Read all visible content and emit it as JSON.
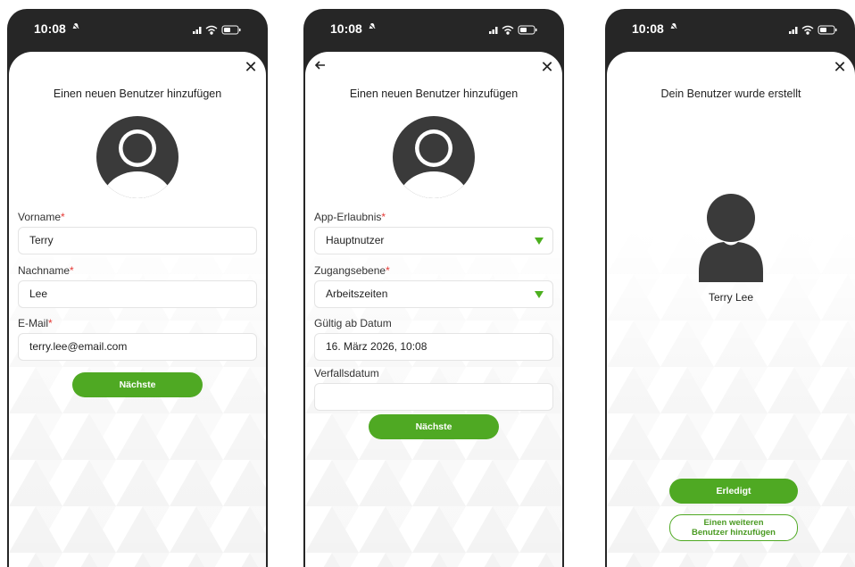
{
  "screens": [
    {
      "time": "10:08",
      "title": "Einen neuen Benutzer hinzufügen",
      "fields": [
        {
          "label": "Vorname",
          "required": "*",
          "value": "Terry"
        },
        {
          "label": "Nachname",
          "required": "*",
          "value": "Lee"
        },
        {
          "label": "E-Mail",
          "required": "*",
          "value": "terry.lee@email.com"
        }
      ],
      "next_button": "Nächste"
    },
    {
      "time": "10:08",
      "title": "Einen neuen Benutzer hinzufügen",
      "fields": [
        {
          "label": "App-Erlaubnis",
          "required": "*",
          "value": "Hauptnutzer"
        },
        {
          "label": "Zugangsebene",
          "required": "*",
          "value": "Arbeitszeiten"
        },
        {
          "label": "Gültig ab Datum",
          "value": "16. März 2026, 10:08"
        },
        {
          "label": "Verfallsdatum",
          "value": ""
        }
      ],
      "next_button": "Nächste"
    },
    {
      "time": "10:08",
      "title": "Dein Benutzer wurde erstellt",
      "user_name": "Terry Lee",
      "done_button": "Erledigt",
      "add_another_line1": "Einen weiteren",
      "add_another_line2": "Benutzer hinzufügen"
    }
  ],
  "icons": {
    "close": "close-icon",
    "back": "arrow-left-icon",
    "silent": "bell-slash-icon",
    "signal": "cellular-signal-icon",
    "wifi": "wifi-icon",
    "battery": "battery-icon",
    "avatar": "user-avatar-icon"
  },
  "colors": {
    "accent": "#4fa923",
    "required": "#e53935",
    "dropdown_arrow": "#4caf1f",
    "phone_frame": "#262626"
  }
}
